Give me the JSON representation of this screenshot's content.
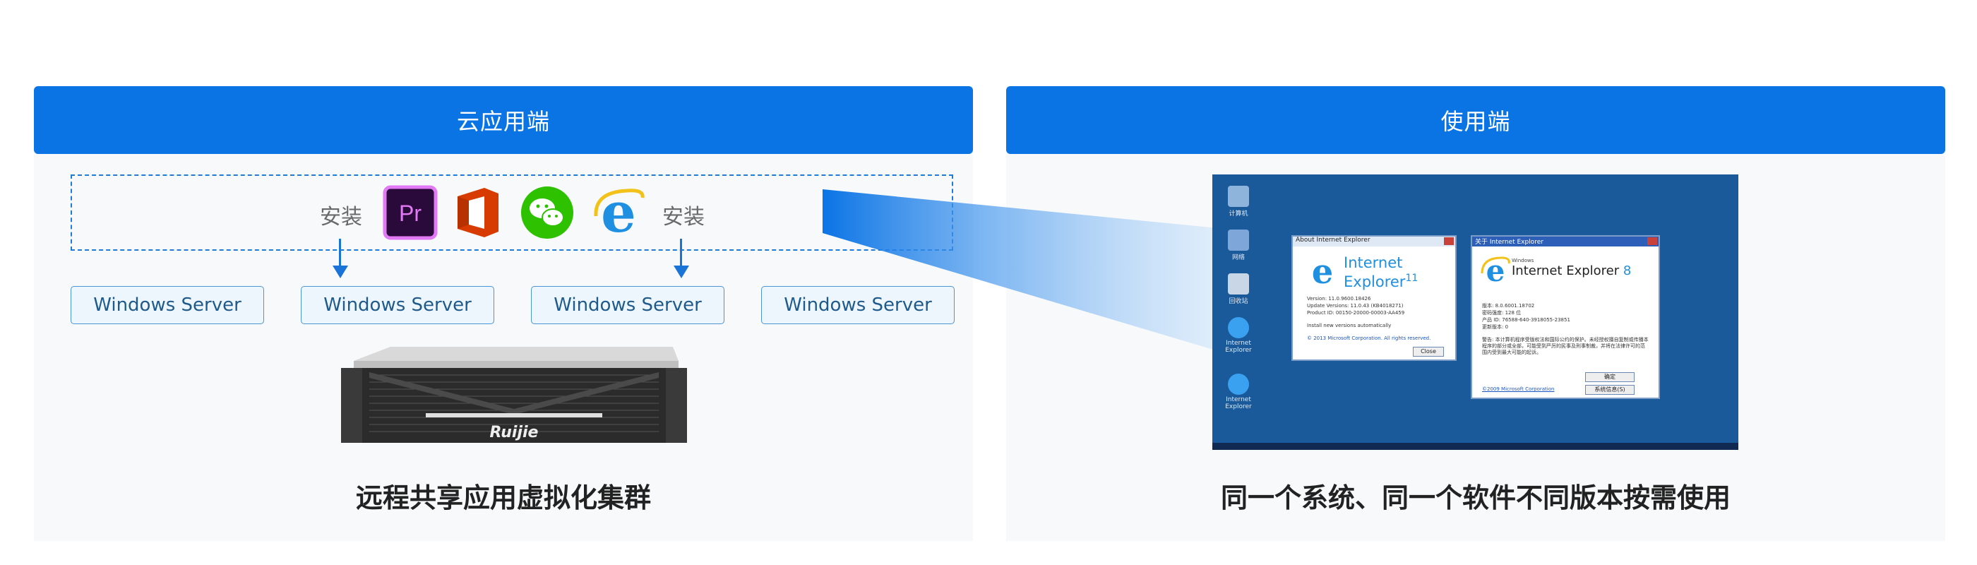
{
  "left_panel": {
    "header": "云应用端",
    "install_left": "安装",
    "install_right": "安装",
    "apps": [
      {
        "name": "Premiere Pro",
        "label": "Pr",
        "icon": "premiere-pro-icon",
        "color": "#2a0a3a",
        "accent": "#e279f5"
      },
      {
        "name": "Office",
        "icon": "office-icon",
        "color": "#d83b01"
      },
      {
        "name": "WeChat",
        "icon": "wechat-icon",
        "color": "#2dc100"
      },
      {
        "name": "Internet Explorer",
        "icon": "internet-explorer-icon",
        "color": "#1e8fe1"
      }
    ],
    "servers": [
      "Windows Server",
      "Windows Server",
      "Windows Server",
      "Windows Server"
    ],
    "hardware_brand": "Ruijie",
    "caption": "远程共享应用虚拟化集群"
  },
  "right_panel": {
    "header": "使用端",
    "caption": "同一个系统、同一个软件不同版本按需使用",
    "desktop_icons": [
      "计算机",
      "网络",
      "回收站",
      "Internet Explorer",
      "Internet Explorer"
    ],
    "dialog_ie11": {
      "title": "About Internet Explorer",
      "product_line1": "Internet",
      "product_line2": "Explorer",
      "version_number": "11",
      "info": [
        "Version: 11.0.9600.18426",
        "Update Versions: 11.0.43 (KB4018271)",
        "Product ID: 00150-20000-00003-AA459"
      ],
      "checkbox": "Install new versions automatically",
      "copyright": "© 2013 Microsoft Corporation. All rights reserved.",
      "close_button": "Close"
    },
    "dialog_ie8": {
      "title": "关于 Internet Explorer",
      "product_prefix": "Windows",
      "product": "Internet Explorer",
      "version_number": "8",
      "info": [
        "版本: 8.0.6001.18702",
        "密码强度: 128 位",
        "产品 ID: 76588-640-3918055-23851",
        "更新版本: 0"
      ],
      "warning": "警告: 本计算机程序受版权法和国际公约的保护。未经授权擅自复制或传播本程序的部分或全部，可能受到严厉的民事及刑事制裁，并将在法律许可的范围内受到最大可能的起诉。",
      "link": "©2009 Microsoft Corporation",
      "ok_button": "确定",
      "sysinfo_button": "系统信息(S)"
    }
  },
  "colors": {
    "header_blue": "#0b74e5",
    "panel_bg": "#f7f9fb",
    "dash_blue": "#1f7bd6",
    "server_border": "#4b94d6"
  }
}
